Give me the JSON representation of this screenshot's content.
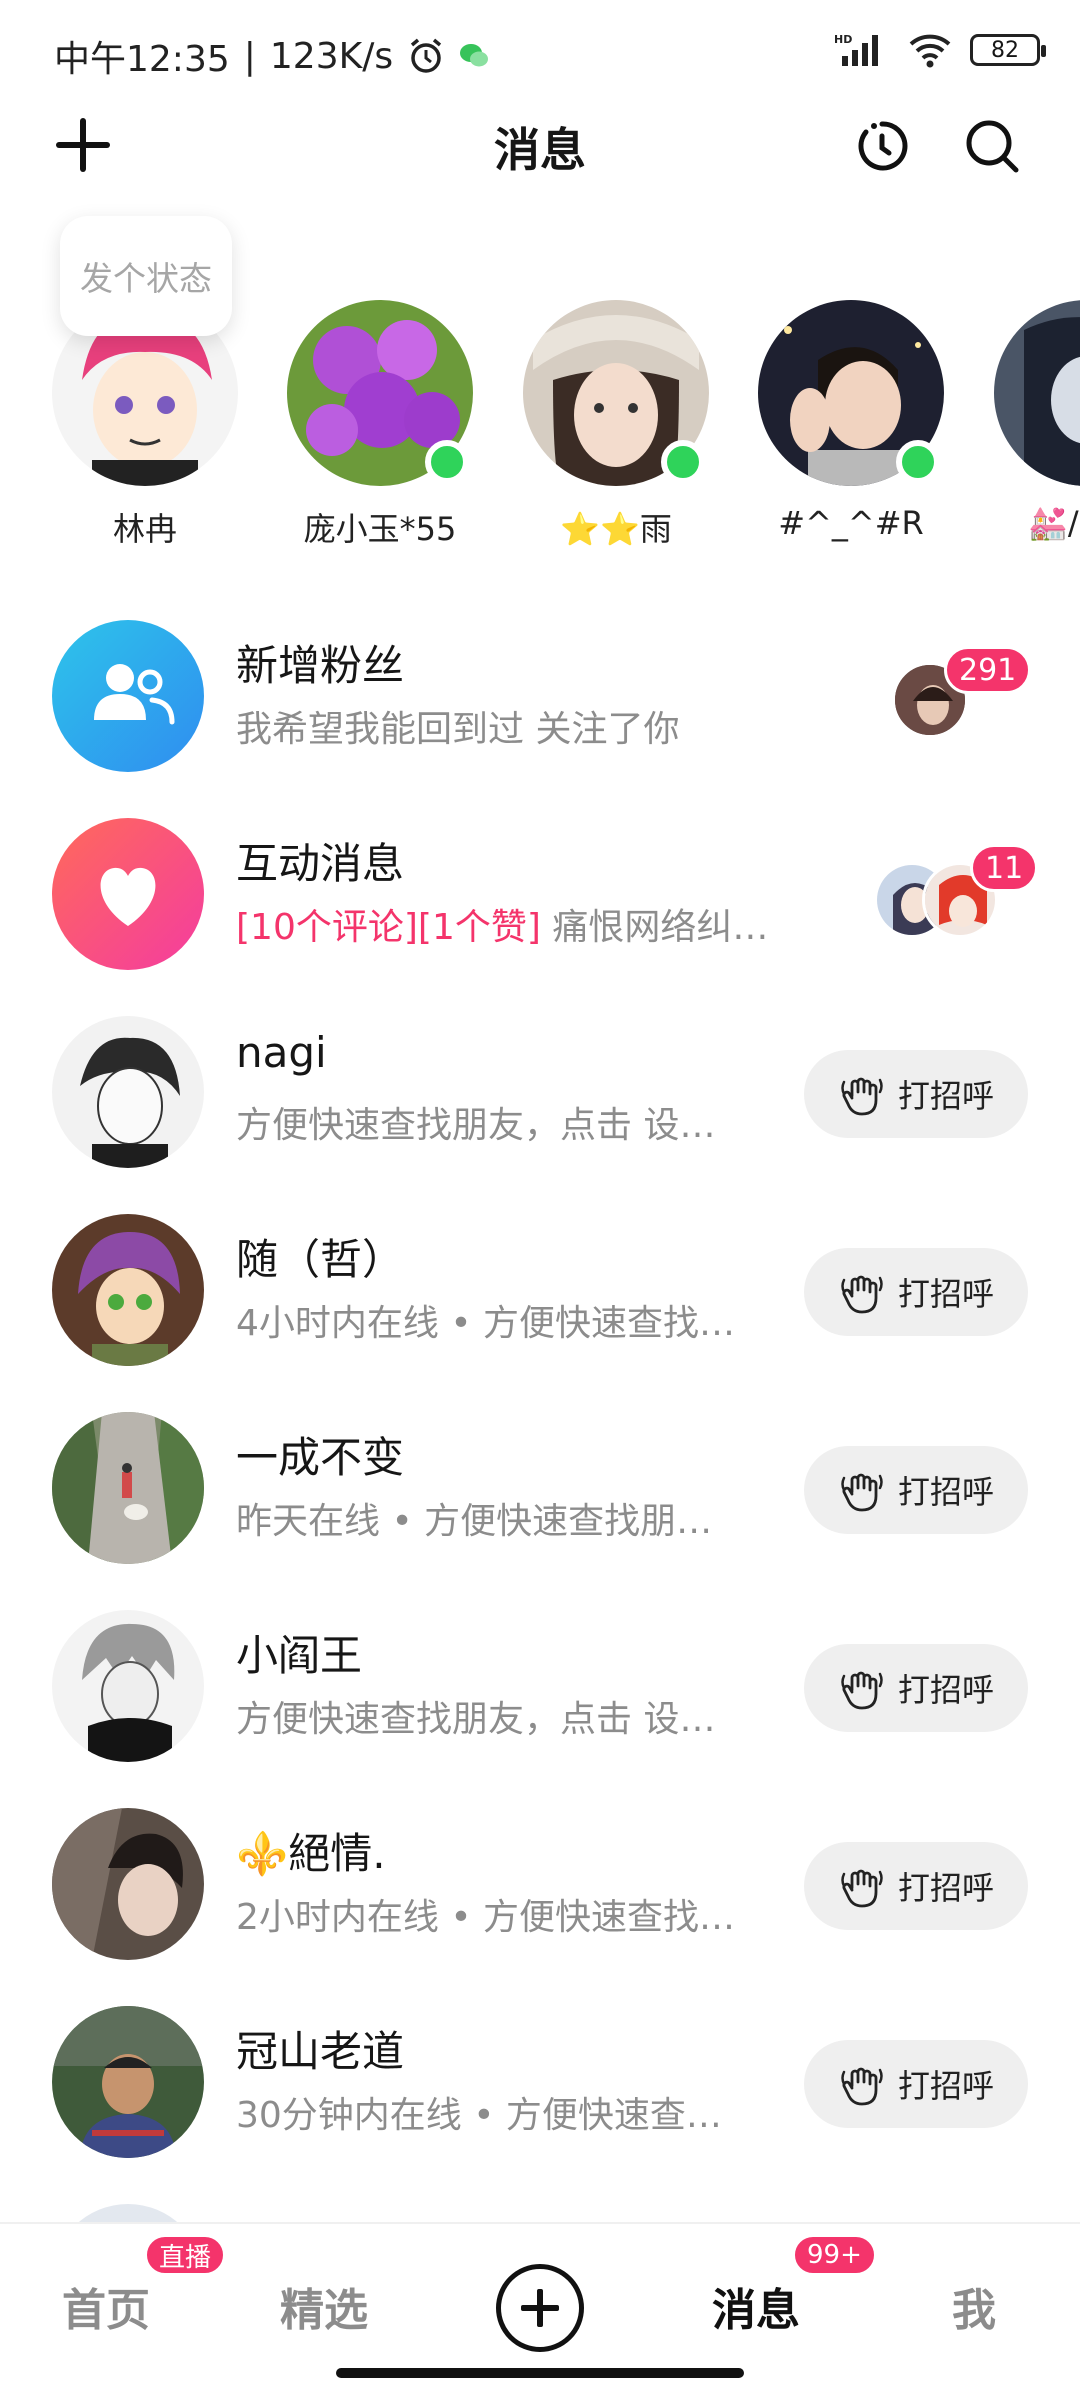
{
  "status_bar": {
    "time": "中午12:35",
    "speed": "123K/s",
    "battery": "82",
    "network": "HD"
  },
  "header": {
    "title": "消息"
  },
  "status_prompt": "发个状态",
  "stories": [
    {
      "name": "林冉",
      "online": false
    },
    {
      "name": "庞小玉*55",
      "online": true
    },
    {
      "name": "⭐⭐雨",
      "online": true
    },
    {
      "name": "#^_^#R",
      "online": true
    },
    {
      "name": "💒/",
      "online": false
    }
  ],
  "system_rows": {
    "fans": {
      "title": "新增粉丝",
      "subtitle": "我希望我能回到过 关注了你",
      "badge": "291"
    },
    "interactions": {
      "title": "互动消息",
      "highlight": "[10个评论][1个赞]",
      "subtitle": " 痛恨网络纠…",
      "badge": "11"
    }
  },
  "greet_label": "打招呼",
  "contacts": [
    {
      "name": "nagi",
      "subtitle": "方便快速查找朋友，点击 设…"
    },
    {
      "name": "随（哲）",
      "subtitle": "4小时内在线 • 方便快速查找…"
    },
    {
      "name": "一成不变",
      "subtitle": "昨天在线 • 方便快速查找朋…"
    },
    {
      "name": "小阎王",
      "subtitle": "方便快速查找朋友，点击 设…"
    },
    {
      "name": "⚜️絕情.",
      "subtitle": "2小时内在线 • 方便快速查找…"
    },
    {
      "name": "冠山老道",
      "subtitle": "30分钟内在线 • 方便快速查…"
    }
  ],
  "bottom_nav": {
    "home": "首页",
    "home_badge": "直播",
    "featured": "精选",
    "messages": "消息",
    "messages_badge": "99+",
    "me": "我"
  },
  "colors": {
    "accent": "#f4346b",
    "online": "#2fd35a",
    "fans_gradient_start": "#2ec4ea",
    "interact_gradient_start": "#ff5a6e"
  }
}
